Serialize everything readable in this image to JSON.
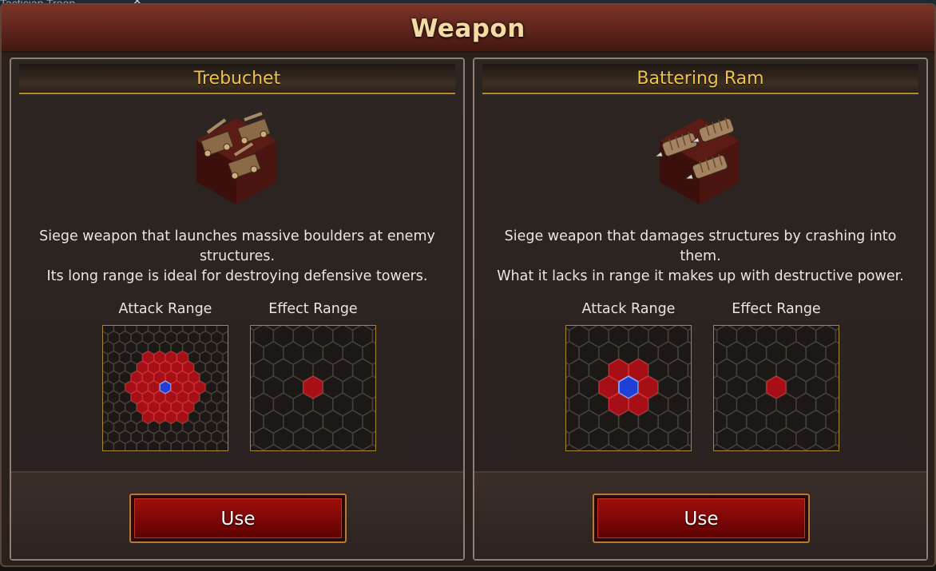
{
  "background": {
    "tab_label": "Tactician Troop"
  },
  "window": {
    "title": "Weapon"
  },
  "weapons": [
    {
      "name": "Trebuchet",
      "icon": "trebuchet-icon",
      "description_line1": "Siege weapon that launches massive boulders at enemy\nstructures.",
      "description_line2": "Its long range is ideal for destroying defensive towers.",
      "attack_range_label": "Attack Range",
      "effect_range_label": "Effect Range",
      "use_label": "Use"
    },
    {
      "name": "Battering Ram",
      "icon": "battering-ram-icon",
      "description_line1": "Siege weapon that damages structures by crashing into\nthem.",
      "description_line2": "What it lacks in range it makes up with destructive power.",
      "attack_range_label": "Attack Range",
      "effect_range_label": "Effect Range",
      "use_label": "Use"
    }
  ],
  "colors": {
    "title_text": "#f3dba4",
    "header_text": "#efc24a",
    "range_hex": "#a60f16",
    "origin_hex": "#1f3fd6",
    "button_red": "#8a0a08"
  }
}
